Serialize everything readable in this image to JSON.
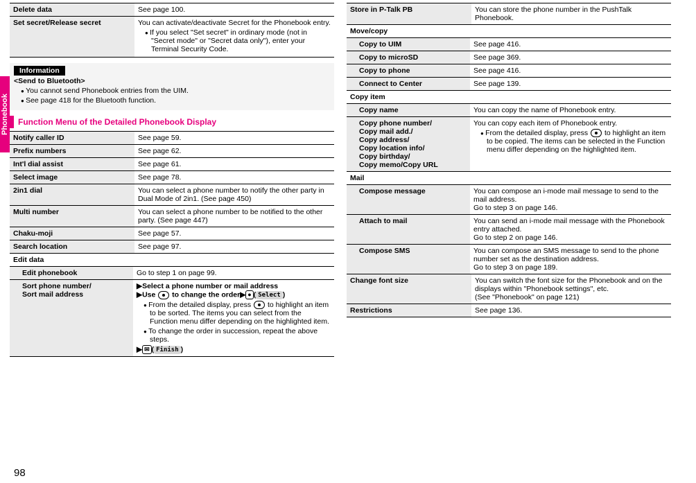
{
  "sidetab": "Phonebook",
  "pageno": "98",
  "left_top": [
    {
      "label": "Delete data",
      "desc": "See page 100."
    },
    {
      "label": "Set secret/Release secret",
      "desc": "You can activate/deactivate Secret for the Phonebook entry.",
      "bullets": [
        "If you select \"Set secret\" in ordinary mode (not in \"Secret mode\" or \"Secret data only\"), enter your Terminal Security Code."
      ]
    }
  ],
  "info": {
    "tag": "Information",
    "title": "<Send to Bluetooth>",
    "bullets": [
      "You cannot send Phonebook entries from the UIM.",
      "See page 418 for the Bluetooth function."
    ]
  },
  "funcbar": "Function Menu of the Detailed Phonebook Display",
  "func_main": [
    {
      "label": "Notify caller ID",
      "desc": "See page 59."
    },
    {
      "label": "Prefix numbers",
      "desc": "See page 62."
    },
    {
      "label": "Int'l dial assist",
      "desc": "See page 61."
    },
    {
      "label": "Select image",
      "desc": "See page 78."
    },
    {
      "label": "2in1 dial",
      "desc": "You can select a phone number to notify the other party in Dual Mode of 2in1. (See page 450)"
    },
    {
      "label": "Multi number",
      "desc": "You can select a phone number to be notified to the other party. (See page 447)"
    },
    {
      "label": "Chaku-moji",
      "desc": "See page 57."
    },
    {
      "label": "Search location",
      "desc": "See page 97."
    }
  ],
  "editdata_hdr": "Edit data",
  "editdata": [
    {
      "label": "Edit phonebook",
      "desc": "Go to step 1 on page 99."
    }
  ],
  "sort": {
    "label": "Sort phone number/\nSort mail address",
    "step1": "Select a phone number or mail address",
    "step2a": "Use ",
    "step2b": " to change the order",
    "select_pill": "Select",
    "bullets": [
      "From the detailed display, press  to highlight an item to be sorted. The items you can select from the Function menu differ depending on the highlighted item.",
      "To change the order in succession, repeat the above steps."
    ],
    "finish_pill": "Finish"
  },
  "right_top": [
    {
      "label": "Store in P-Talk PB",
      "desc": "You can store the phone number in the PushTalk Phonebook."
    }
  ],
  "movecopy_hdr": "Move/copy",
  "movecopy": [
    {
      "label": "Copy to UIM",
      "desc": "See page 416."
    },
    {
      "label": "Copy to microSD",
      "desc": "See page 369."
    },
    {
      "label": "Copy to phone",
      "desc": "See page 416."
    },
    {
      "label": "Connect to Center",
      "desc": "See page 139."
    }
  ],
  "copyitem_hdr": "Copy item",
  "copyitem": [
    {
      "label": "Copy name",
      "desc": "You can copy the name of Phonebook entry."
    }
  ],
  "copyeach": {
    "label": "Copy phone number/\nCopy mail add./\nCopy address/\nCopy location info/\nCopy birthday/\nCopy memo/Copy URL",
    "desc": "You can copy each item of Phonebook entry.",
    "bullet_a": "From the detailed display, press ",
    "bullet_b": " to highlight an item to be copied. The items can be selected in the Function menu differ depending on the highlighted item."
  },
  "mail_hdr": "Mail",
  "mail": [
    {
      "label": "Compose message",
      "desc": "You can compose an i-mode mail message to send to the mail address.\nGo to step 3 on page 146."
    },
    {
      "label": "Attach to mail",
      "desc": "You can send an i-mode mail message with the Phonebook entry attached.\nGo to step 2 on page 146."
    },
    {
      "label": "Compose SMS",
      "desc": "You can compose an SMS message to send to the phone number set as the destination address.\nGo to step 3 on page 189."
    }
  ],
  "right_tail": [
    {
      "label": "Change font size",
      "desc": "You can switch the font size for the Phonebook and on the displays within \"Phonebook settings\", etc.\n(See \"Phonebook\" on page 121)"
    },
    {
      "label": "Restrictions",
      "desc": "See page 136."
    }
  ]
}
